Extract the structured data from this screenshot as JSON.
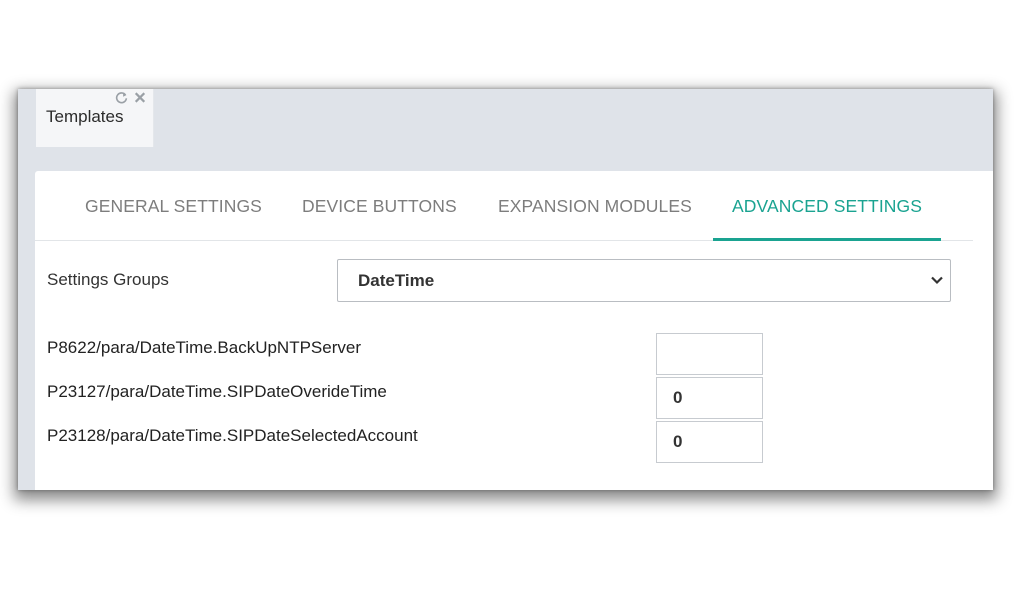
{
  "window": {
    "tab": {
      "title": "Templates",
      "refresh_icon": "refresh-icon",
      "close_icon": "close-icon"
    }
  },
  "settings_tabs": [
    {
      "label": "GENERAL SETTINGS",
      "active": false
    },
    {
      "label": "DEVICE BUTTONS",
      "active": false
    },
    {
      "label": "EXPANSION MODULES",
      "active": false
    },
    {
      "label": "ADVANCED SETTINGS",
      "active": true
    }
  ],
  "settings_groups": {
    "label": "Settings Groups",
    "selected": "DateTime",
    "chevron_icon": "chevron-down-icon"
  },
  "params": [
    {
      "label": "P8622/para/DateTime.BackUpNTPServer",
      "value": ""
    },
    {
      "label": "P23127/para/DateTime.SIPDateOverideTime",
      "value": "0"
    },
    {
      "label": "P23128/para/DateTime.SIPDateSelectedAccount",
      "value": "0"
    }
  ],
  "colors": {
    "accent": "#1aa391",
    "tab_text": "#7d7d7d",
    "tabstrip_bg": "#dfe3e9"
  }
}
